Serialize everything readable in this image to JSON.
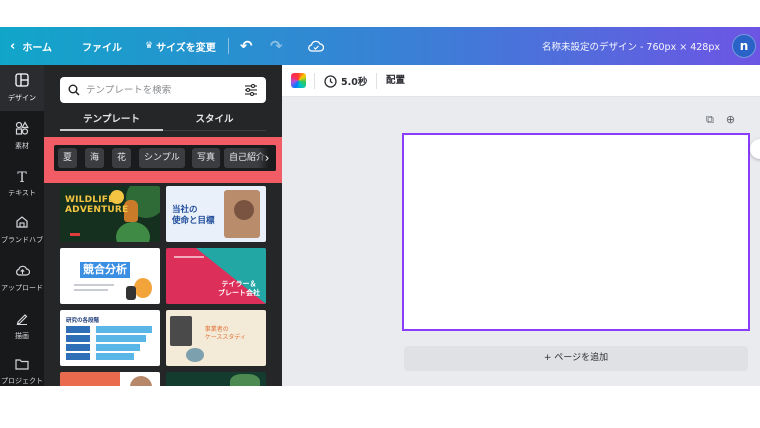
{
  "topbar": {
    "home_label": "ホーム",
    "file_label": "ファイル",
    "resize_label": "サイズを変更",
    "doc_title": "名称未設定のデザイン - 760px × 428px",
    "avatar_initial": "n"
  },
  "rail": {
    "items": [
      {
        "label": "デザイン",
        "icon": "layout-icon"
      },
      {
        "label": "素材",
        "icon": "elements-icon"
      },
      {
        "label": "テキスト",
        "icon": "text-icon"
      },
      {
        "label": "ブランドハブ",
        "icon": "brand-icon"
      },
      {
        "label": "アップロード",
        "icon": "upload-icon"
      },
      {
        "label": "描画",
        "icon": "draw-icon"
      },
      {
        "label": "プロジェクト",
        "icon": "folder-icon"
      }
    ]
  },
  "panel": {
    "search_placeholder": "テンプレートを検索",
    "tabs": [
      "テンプレート",
      "スタイル"
    ],
    "chips": [
      "夏",
      "海",
      "花",
      "シンプル",
      "写真",
      "自己紹介"
    ],
    "templates": {
      "wildlife_line1": "WILDLIFE",
      "wildlife_line2": "ADVENTURE",
      "mission_line1": "当社の",
      "mission_line2": "使命と目標",
      "competition": "競合分析",
      "teal_line1": "テイラー＆",
      "teal_line2": "ブレート会社",
      "flow_title": "研究の各段階",
      "paper_line1": "事業者の",
      "paper_line2": "ケーススタディ"
    }
  },
  "editor": {
    "duration": "5.0秒",
    "position_label": "配置",
    "add_page_label": "+ ページを追加"
  }
}
